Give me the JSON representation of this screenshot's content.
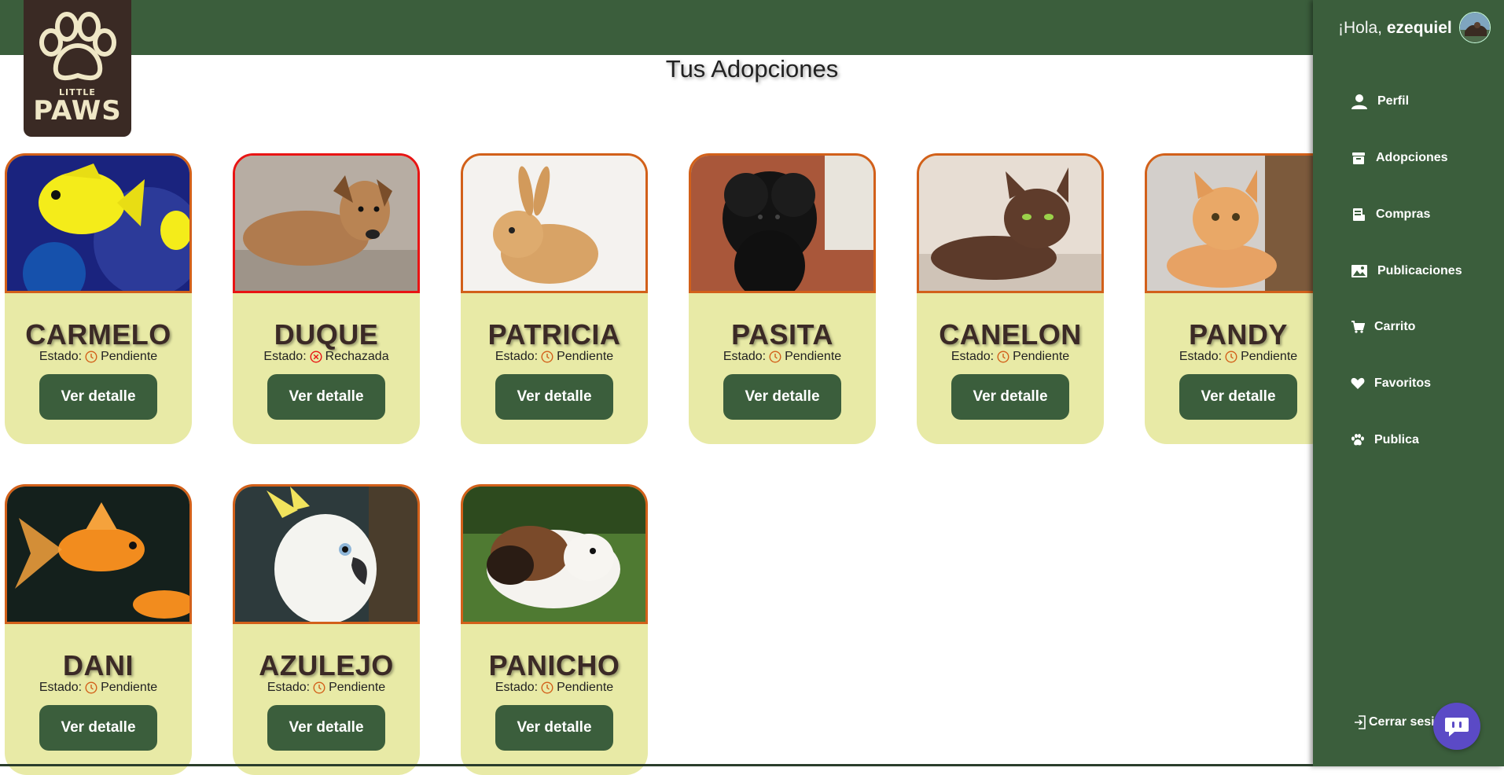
{
  "brand": {
    "line1": "LITTLE",
    "line2": "PAWS"
  },
  "page": {
    "title": "Tus Adopciones"
  },
  "user": {
    "greeting": "¡Hola, ",
    "name": "ezequiel"
  },
  "sidebar": {
    "items": [
      {
        "label": "Perfil",
        "icon": "user-icon"
      },
      {
        "label": "Adopciones",
        "icon": "archive-icon"
      },
      {
        "label": "Compras",
        "icon": "receipt-icon"
      },
      {
        "label": "Publicaciones",
        "icon": "image-icon"
      },
      {
        "label": "Carrito",
        "icon": "cart-icon"
      },
      {
        "label": "Favoritos",
        "icon": "heart-icon"
      },
      {
        "label": "Publica",
        "icon": "paw-icon"
      }
    ],
    "logout": "Cerrar sesi"
  },
  "status_label": "Estado:",
  "detail_button": "Ver detalle",
  "adoptions": [
    {
      "name": "CARMELO",
      "status": "Pendiente",
      "status_icon": "clock-icon",
      "photo": "yellow-fish"
    },
    {
      "name": "DUQUE",
      "status": "Rechazada",
      "status_icon": "x-circle-icon",
      "photo": "brown-puppy"
    },
    {
      "name": "PATRICIA",
      "status": "Pendiente",
      "status_icon": "clock-icon",
      "photo": "rabbit"
    },
    {
      "name": "PASITA",
      "status": "Pendiente",
      "status_icon": "clock-icon",
      "photo": "black-poodle"
    },
    {
      "name": "CANELON",
      "status": "Pendiente",
      "status_icon": "clock-icon",
      "photo": "brown-cat"
    },
    {
      "name": "PANDY",
      "status": "Pendiente",
      "status_icon": "clock-icon",
      "photo": "orange-cat"
    },
    {
      "name": "DANI",
      "status": "Pendiente",
      "status_icon": "clock-icon",
      "photo": "goldfish"
    },
    {
      "name": "AZULEJO",
      "status": "Pendiente",
      "status_icon": "clock-icon",
      "photo": "cockatoo"
    },
    {
      "name": "PANICHO",
      "status": "Pendiente",
      "status_icon": "clock-icon",
      "photo": "guinea-pig"
    }
  ],
  "colors": {
    "primary": "#3b5e3c",
    "card": "#e8eaa6",
    "pending": "#d2601a",
    "rejected": "#e81414",
    "chat": "#5b4ac6"
  }
}
